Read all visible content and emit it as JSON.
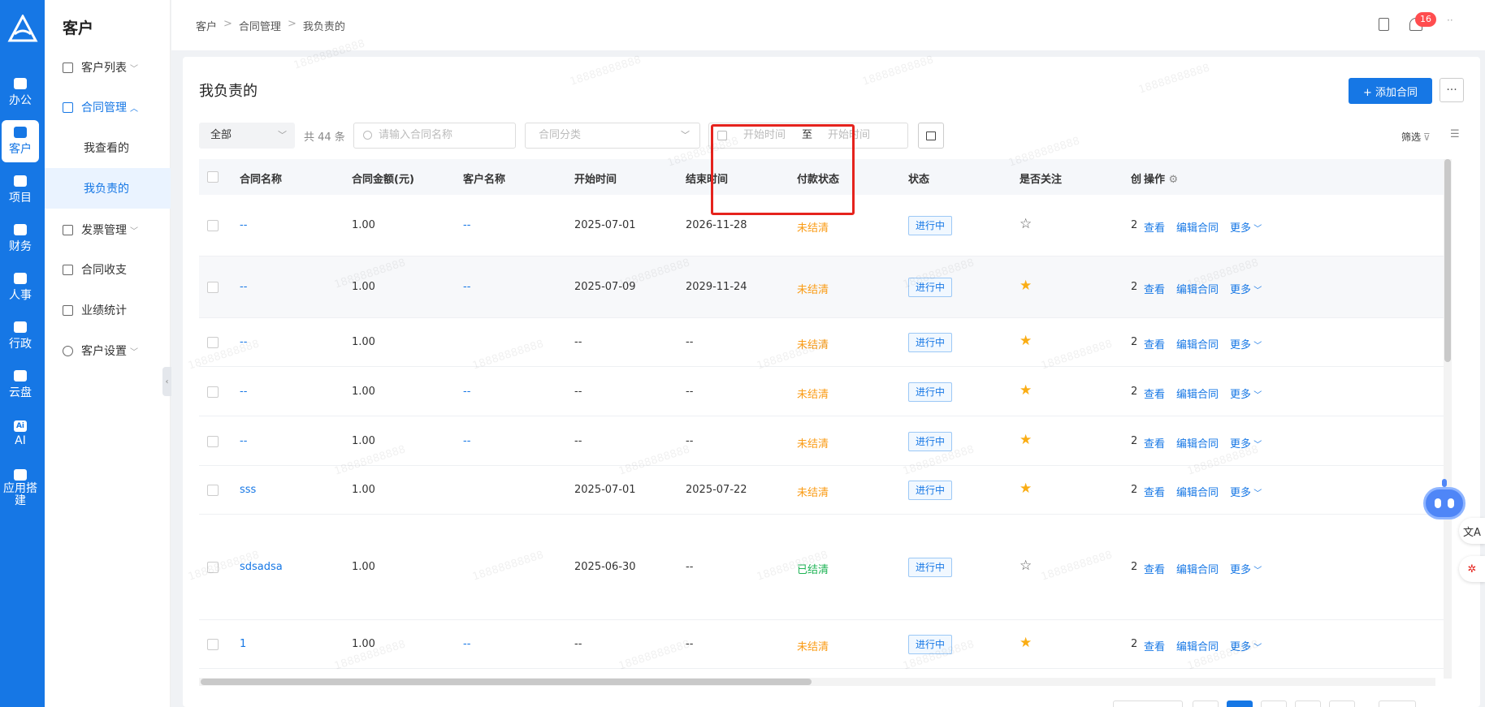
{
  "nav": {
    "items": [
      {
        "label": "办公",
        "icon": "office-icon"
      },
      {
        "label": "客户",
        "icon": "customer-icon"
      },
      {
        "label": "项目",
        "icon": "project-icon"
      },
      {
        "label": "财务",
        "icon": "finance-icon"
      },
      {
        "label": "人事",
        "icon": "hr-icon"
      },
      {
        "label": "行政",
        "icon": "admin-icon"
      },
      {
        "label": "云盘",
        "icon": "cloud-drive-icon"
      },
      {
        "label": "AI",
        "icon": "ai-icon"
      },
      {
        "label": "应用搭建",
        "icon": "app-builder-icon"
      }
    ]
  },
  "sidebar": {
    "title": "客户",
    "menus": {
      "customer_list": "客户列表",
      "contract_mgmt": "合同管理",
      "viewed": "我查看的",
      "responsible": "我负责的",
      "invoice_mgmt": "发票管理",
      "contract_payments": "合同收支",
      "performance": "业绩统计",
      "customer_settings": "客户设置"
    }
  },
  "header": {
    "breadcrumb": [
      "客户",
      "合同管理",
      "我负责的"
    ],
    "notification_count": "16",
    "more": "··"
  },
  "page": {
    "title": "我负责的",
    "add_button": "+ 添加合同",
    "more_button": "···",
    "filter_label": "筛选",
    "scope_select": "全部",
    "count_text": "共 44 条",
    "search_placeholder": "请输入合同名称",
    "category_placeholder": "合同分类",
    "date_start_placeholder": "开始时间",
    "date_to": "至",
    "date_end_placeholder": "开始时间"
  },
  "table": {
    "headers": {
      "name": "合同名称",
      "amount": "合同金额(元)",
      "customer": "客户名称",
      "start": "开始时间",
      "end": "结束时间",
      "payment": "付款状态",
      "status": "状态",
      "followed": "是否关注",
      "truncated": "创",
      "actions": "操作"
    },
    "action_labels": {
      "view": "查看",
      "edit": "编辑合同",
      "more": "更多"
    },
    "rows": [
      {
        "name": "--",
        "amount": "1.00",
        "customer": "--",
        "start": "2025-07-01",
        "end": "2026-11-28",
        "payment": "未结清",
        "status": "进行中",
        "followed": false,
        "created_trunc": "2"
      },
      {
        "name": "--",
        "amount": "1.00",
        "customer": "--",
        "start": "2025-07-09",
        "end": "2029-11-24",
        "payment": "未结清",
        "status": "进行中",
        "followed": true,
        "created_trunc": "2"
      },
      {
        "name": "--",
        "amount": "1.00",
        "customer": "",
        "start": "--",
        "end": "--",
        "payment": "未结清",
        "status": "进行中",
        "followed": true,
        "created_trunc": "2"
      },
      {
        "name": "--",
        "amount": "1.00",
        "customer": "--",
        "start": "--",
        "end": "--",
        "payment": "未结清",
        "status": "进行中",
        "followed": true,
        "created_trunc": "2"
      },
      {
        "name": "--",
        "amount": "1.00",
        "customer": "--",
        "start": "--",
        "end": "--",
        "payment": "未结清",
        "status": "进行中",
        "followed": true,
        "created_trunc": "2"
      },
      {
        "name": "sss",
        "amount": "1.00",
        "customer": "",
        "start": "2025-07-01",
        "end": "2025-07-22",
        "payment": "未结清",
        "status": "进行中",
        "followed": true,
        "created_trunc": "2"
      },
      {
        "name": "sdsadsa",
        "amount": "1.00",
        "customer": "",
        "start": "2025-06-30",
        "end": "--",
        "payment": "已结清",
        "status": "进行中",
        "followed": false,
        "created_trunc": "2"
      },
      {
        "name": "1",
        "amount": "1.00",
        "customer": "--",
        "start": "--",
        "end": "--",
        "payment": "未结清",
        "status": "进行中",
        "followed": true,
        "created_trunc": "2"
      }
    ]
  },
  "watermark": "18888888888",
  "colors": {
    "primary": "#1677e5",
    "unpaid": "#fa9b14",
    "paid": "#1db354",
    "star": "#faad14",
    "highlight": "#e5231d"
  }
}
